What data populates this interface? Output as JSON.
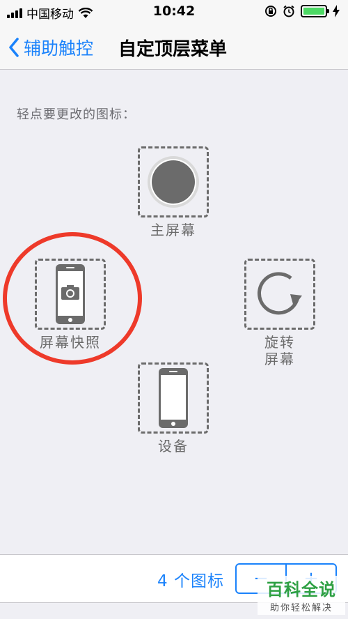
{
  "status_bar": {
    "carrier": "中国移动",
    "time": "10:42",
    "battery_color": "#4cd964"
  },
  "nav": {
    "back_label": "辅助触控",
    "title": "自定顶层菜单"
  },
  "section_label": "轻点要更改的图标：",
  "icons": {
    "top": {
      "label": "主屏幕",
      "icon": "home-button-icon"
    },
    "left": {
      "label": "屏幕快照",
      "icon": "screenshot-phone-camera-icon"
    },
    "right": {
      "label_line1": "旋转",
      "label_line2": "屏幕",
      "icon": "rotate-arrow-icon"
    },
    "bottom": {
      "label": "设备",
      "icon": "device-phone-icon"
    }
  },
  "highlight_color": "#ee3a2a",
  "accent_color": "#1a82fb",
  "bottom_bar": {
    "count_label": "4 个图标",
    "minus": "−",
    "plus": "+"
  },
  "watermark": {
    "title": "百科全说",
    "subtitle": "助你轻松解决"
  }
}
